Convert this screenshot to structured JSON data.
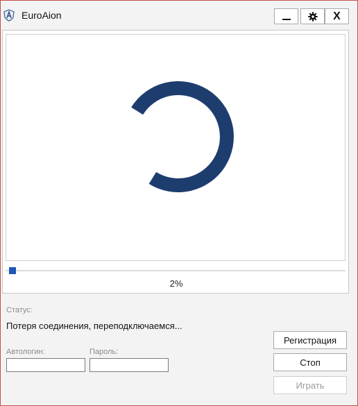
{
  "window": {
    "title": "EuroAion"
  },
  "titlebar": {
    "minimize_icon": "minimize-icon",
    "settings_icon": "gear-icon",
    "close_label": "X"
  },
  "progress": {
    "value_percent": 2,
    "label": "2%",
    "spinner_color": "#1e3d6f",
    "accent_color": "#1f57b7"
  },
  "status": {
    "label": "Статус:",
    "text": "Потеря соединения, переподключаемся..."
  },
  "login": {
    "autologin_label": "Автологин:",
    "autologin_value": "",
    "password_label": "Пароль:",
    "password_value": ""
  },
  "actions": {
    "register_label": "Регистрация",
    "stop_label": "Стоп",
    "play_label": "Играть"
  }
}
